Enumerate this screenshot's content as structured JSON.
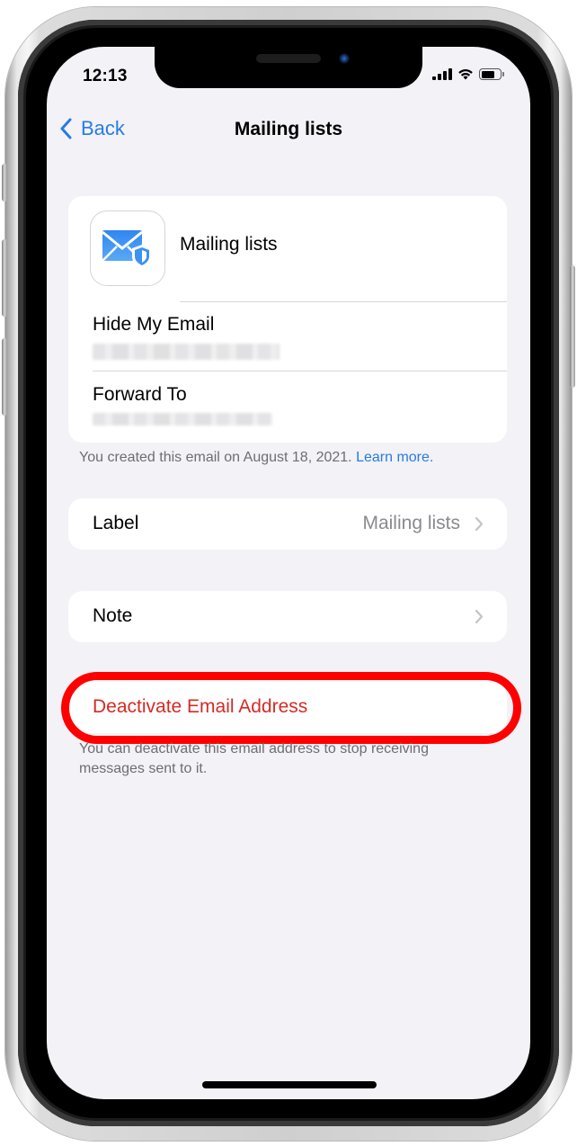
{
  "status_bar": {
    "time": "12:13",
    "icons": [
      "cellular-signal-icon",
      "wifi-icon",
      "battery-icon"
    ]
  },
  "nav": {
    "back_label": "Back",
    "title": "Mailing lists"
  },
  "header_card": {
    "app_icon": "mail-shield-icon",
    "app_name": "Mailing lists",
    "fields": [
      {
        "label": "Hide My Email",
        "value": "[redacted]"
      },
      {
        "label": "Forward To",
        "value": "[redacted]"
      }
    ]
  },
  "created_note": {
    "text": "You created this email on August 18, 2021. ",
    "link": "Learn more."
  },
  "label_row": {
    "label": "Label",
    "value": "Mailing lists"
  },
  "note_row": {
    "label": "Note"
  },
  "deactivate": {
    "label": "Deactivate Email Address",
    "footnote_line1": "You can deactivate this email address to stop receiving",
    "footnote_line2": "messages sent to it."
  },
  "colors": {
    "accent": "#2a7ae4",
    "destructive": "#d52b24",
    "highlight": "#ff0000",
    "background": "#f2f2f7"
  }
}
